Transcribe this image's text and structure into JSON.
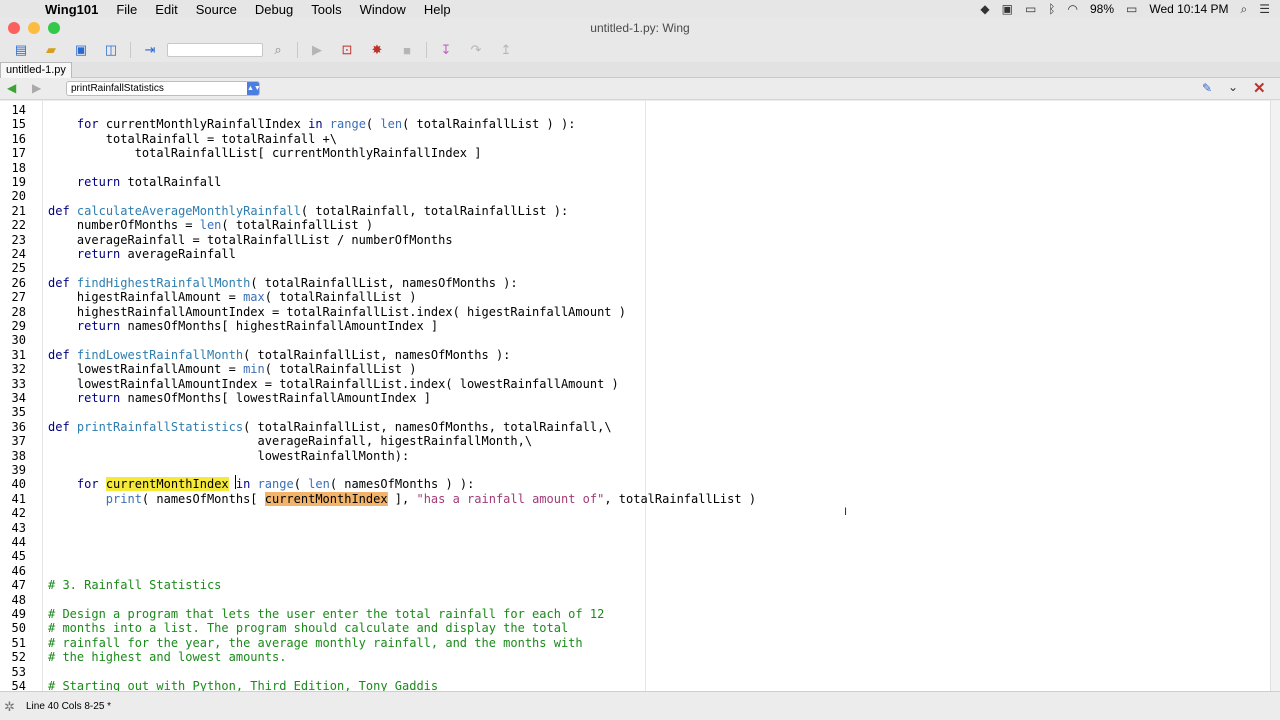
{
  "menubar": {
    "apple_glyph": "",
    "app_name": "Wing101",
    "items": [
      "File",
      "Edit",
      "Source",
      "Debug",
      "Tools",
      "Window",
      "Help"
    ],
    "battery": "98%",
    "clock": "Wed 10:14 PM"
  },
  "window": {
    "title": "untitled-1.py: Wing"
  },
  "toolbar": {
    "icons": [
      "new-file-icon",
      "open-folder-icon",
      "save-icon",
      "save-all-icon",
      "indent-icon",
      "search-icon",
      "run-icon",
      "debug-icon",
      "bug-icon",
      "stop-icon",
      "step-into-icon",
      "step-over-icon",
      "step-out-icon"
    ]
  },
  "tabs": [
    {
      "label": "untitled-1.py"
    }
  ],
  "nav": {
    "scope": "printRainfallStatistics"
  },
  "colors": {
    "keyword": "#000080",
    "function_name": "#2e7db0",
    "builtin": "#3b6fb6",
    "string": "#a23b78",
    "comment": "#1a8a1a",
    "highlight_yellow": "#f5e93a",
    "highlight_orange": "#f2b36a"
  },
  "code": [
    {
      "n": "14",
      "segs": []
    },
    {
      "n": "15",
      "segs": [
        {
          "t": "    "
        },
        {
          "t": "for",
          "c": "kw"
        },
        {
          "t": " currentMonthlyRainfallIndex "
        },
        {
          "t": "in",
          "c": "kw"
        },
        {
          "t": " "
        },
        {
          "t": "range",
          "c": "bi"
        },
        {
          "t": "( "
        },
        {
          "t": "len",
          "c": "bi"
        },
        {
          "t": "( totalRainfallList ) ):"
        }
      ]
    },
    {
      "n": "16",
      "segs": [
        {
          "t": "        totalRainfall = totalRainfall +\\"
        }
      ]
    },
    {
      "n": "17",
      "segs": [
        {
          "t": "            totalRainfallList[ currentMonthlyRainfallIndex ]"
        }
      ]
    },
    {
      "n": "18",
      "segs": []
    },
    {
      "n": "19",
      "segs": [
        {
          "t": "    "
        },
        {
          "t": "return",
          "c": "kw"
        },
        {
          "t": " totalRainfall"
        }
      ]
    },
    {
      "n": "20",
      "segs": []
    },
    {
      "n": "21",
      "segs": [
        {
          "t": "def",
          "c": "kw"
        },
        {
          "t": " "
        },
        {
          "t": "calculateAverageMonthlyRainfall",
          "c": "fn"
        },
        {
          "t": "( totalRainfall, totalRainfallList ):"
        }
      ]
    },
    {
      "n": "22",
      "segs": [
        {
          "t": "    numberOfMonths = "
        },
        {
          "t": "len",
          "c": "bi"
        },
        {
          "t": "( totalRainfallList )"
        }
      ]
    },
    {
      "n": "23",
      "segs": [
        {
          "t": "    averageRainfall = totalRainfallList / numberOfMonths"
        }
      ]
    },
    {
      "n": "24",
      "segs": [
        {
          "t": "    "
        },
        {
          "t": "return",
          "c": "kw"
        },
        {
          "t": " averageRainfall"
        }
      ]
    },
    {
      "n": "25",
      "segs": []
    },
    {
      "n": "26",
      "segs": [
        {
          "t": "def",
          "c": "kw"
        },
        {
          "t": " "
        },
        {
          "t": "findHighestRainfallMonth",
          "c": "fn"
        },
        {
          "t": "( totalRainfallList, namesOfMonths ):"
        }
      ]
    },
    {
      "n": "27",
      "segs": [
        {
          "t": "    higestRainfallAmount = "
        },
        {
          "t": "max",
          "c": "bi"
        },
        {
          "t": "( totalRainfallList )"
        }
      ]
    },
    {
      "n": "28",
      "segs": [
        {
          "t": "    highestRainfallAmountIndex = totalRainfallList.index( higestRainfallAmount )"
        }
      ]
    },
    {
      "n": "29",
      "segs": [
        {
          "t": "    "
        },
        {
          "t": "return",
          "c": "kw"
        },
        {
          "t": " namesOfMonths[ highestRainfallAmountIndex ]"
        }
      ]
    },
    {
      "n": "30",
      "segs": []
    },
    {
      "n": "31",
      "segs": [
        {
          "t": "def",
          "c": "kw"
        },
        {
          "t": " "
        },
        {
          "t": "findLowestRainfallMonth",
          "c": "fn"
        },
        {
          "t": "( totalRainfallList, namesOfMonths ):"
        }
      ]
    },
    {
      "n": "32",
      "segs": [
        {
          "t": "    lowestRainfallAmount = "
        },
        {
          "t": "min",
          "c": "bi"
        },
        {
          "t": "( totalRainfallList )"
        }
      ]
    },
    {
      "n": "33",
      "segs": [
        {
          "t": "    lowestRainfallAmountIndex = totalRainfallList.index( lowestRainfallAmount )"
        }
      ]
    },
    {
      "n": "34",
      "segs": [
        {
          "t": "    "
        },
        {
          "t": "return",
          "c": "kw"
        },
        {
          "t": " namesOfMonths[ lowestRainfallAmountIndex ]"
        }
      ]
    },
    {
      "n": "35",
      "segs": []
    },
    {
      "n": "36",
      "segs": [
        {
          "t": "def",
          "c": "kw"
        },
        {
          "t": " "
        },
        {
          "t": "printRainfallStatistics",
          "c": "fn"
        },
        {
          "t": "( totalRainfallList, namesOfMonths, totalRainfall,\\"
        }
      ]
    },
    {
      "n": "37",
      "segs": [
        {
          "t": "                             averageRainfall, higestRainfallMonth,\\"
        }
      ]
    },
    {
      "n": "38",
      "segs": [
        {
          "t": "                             lowestRainfallMonth):"
        }
      ]
    },
    {
      "n": "39",
      "segs": []
    },
    {
      "n": "40",
      "segs": [
        {
          "t": "    "
        },
        {
          "t": "for",
          "c": "kw"
        },
        {
          "t": " "
        },
        {
          "t": "currentMonthIndex",
          "c": "hl-y"
        },
        {
          "t": " "
        },
        {
          "t": "in",
          "c": "kw"
        },
        {
          "t": " "
        },
        {
          "t": "range",
          "c": "bi"
        },
        {
          "t": "( "
        },
        {
          "t": "len",
          "c": "bi"
        },
        {
          "t": "( namesOfMonths ) ):"
        }
      ]
    },
    {
      "n": "41",
      "segs": [
        {
          "t": "        "
        },
        {
          "t": "print",
          "c": "bi"
        },
        {
          "t": "( namesOfMonths[ "
        },
        {
          "t": "currentMonthIndex",
          "c": "hl-o"
        },
        {
          "t": " ], "
        },
        {
          "t": "\"has a rainfall amount of\"",
          "c": "str"
        },
        {
          "t": ", totalRainfallList )"
        }
      ]
    },
    {
      "n": "42",
      "segs": []
    },
    {
      "n": "43",
      "segs": []
    },
    {
      "n": "44",
      "segs": []
    },
    {
      "n": "45",
      "segs": []
    },
    {
      "n": "46",
      "segs": []
    },
    {
      "n": "47",
      "segs": [
        {
          "t": "# 3. Rainfall Statistics",
          "c": "cm"
        }
      ]
    },
    {
      "n": "48",
      "segs": []
    },
    {
      "n": "49",
      "segs": [
        {
          "t": "# Design a program that lets the user enter the total rainfall for each of 12",
          "c": "cm"
        }
      ]
    },
    {
      "n": "50",
      "segs": [
        {
          "t": "# months into a list. The program should calculate and display the total",
          "c": "cm"
        }
      ]
    },
    {
      "n": "51",
      "segs": [
        {
          "t": "# rainfall for the year, the average monthly rainfall, and the months with",
          "c": "cm"
        }
      ]
    },
    {
      "n": "52",
      "segs": [
        {
          "t": "# the highest and lowest amounts.",
          "c": "cm"
        }
      ]
    },
    {
      "n": "53",
      "segs": []
    },
    {
      "n": "54",
      "segs": [
        {
          "t": "# Starting out with Python, Third Edition, Tony Gaddis",
          "c": "cm"
        }
      ]
    }
  ],
  "status": {
    "text": "Line 40 Cols 8-25 *"
  }
}
